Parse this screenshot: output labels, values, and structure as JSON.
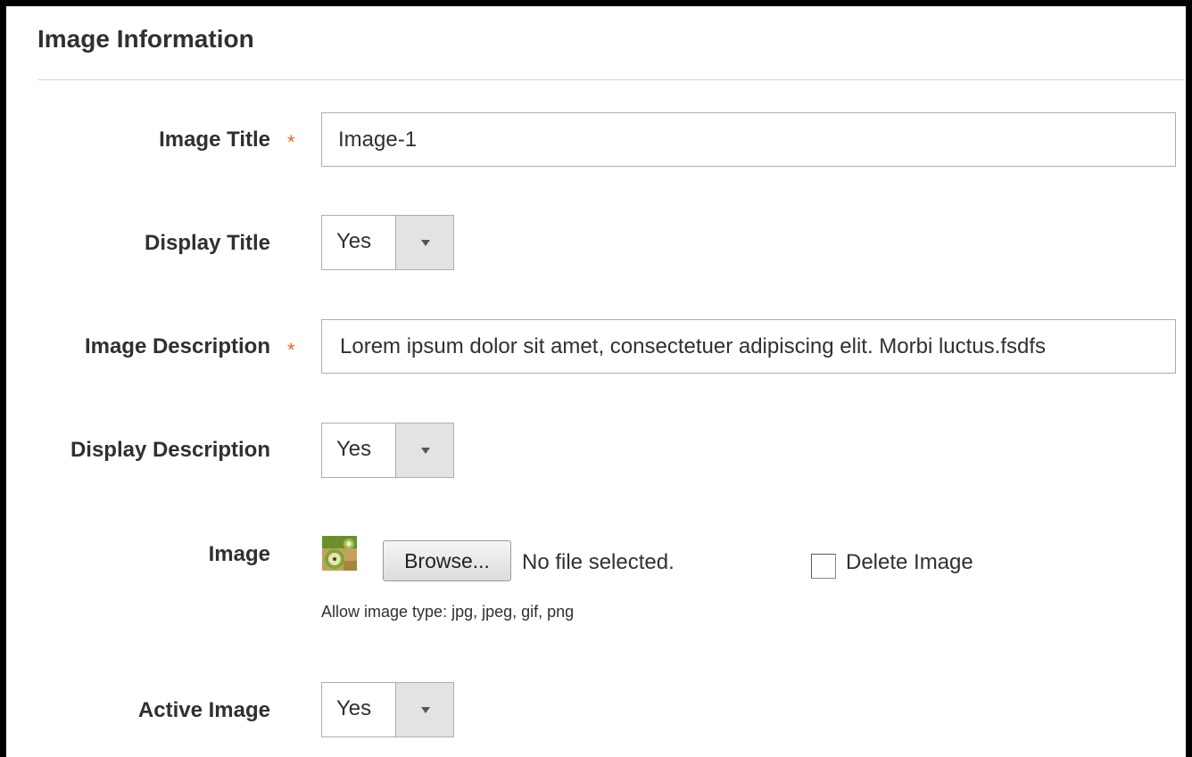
{
  "section": {
    "title": "Image Information"
  },
  "fields": {
    "image_title": {
      "label": "Image Title",
      "required_mark": "*",
      "value": "Image-1"
    },
    "display_title": {
      "label": "Display Title",
      "value": "Yes"
    },
    "image_description": {
      "label": "Image Description",
      "required_mark": "*",
      "value": "Lorem ipsum dolor sit amet, consectetuer adipiscing elit. Morbi luctus.fsdfs"
    },
    "display_description": {
      "label": "Display Description",
      "value": "Yes"
    },
    "image": {
      "label": "Image",
      "browse_label": "Browse...",
      "file_status": "No file selected.",
      "delete_label": "Delete Image",
      "delete_checked": false,
      "hint": "Allow image type: jpg, jpeg, gif, png",
      "thumbnail_icon": "kiwi-thumbnail-icon"
    },
    "active_image": {
      "label": "Active Image",
      "value": "Yes"
    }
  },
  "colors": {
    "required": "#e06b1f",
    "border": "#adadad",
    "select_arrow_bg": "#e3e3e3",
    "text": "#303030"
  }
}
